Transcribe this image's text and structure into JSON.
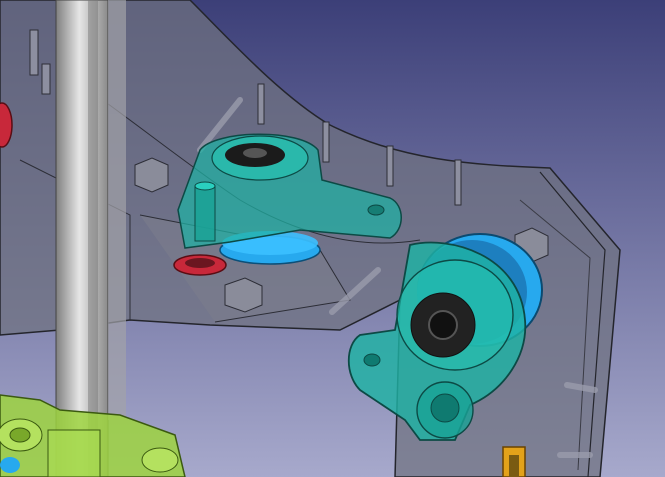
{
  "app": {
    "view": "3D viewport",
    "render_style": "shaded transparent"
  },
  "colors": {
    "background_top": "#3c3f78",
    "background_bottom": "#a7a9cc",
    "housing": "#6f7180",
    "bracket": "#1fb2a4",
    "pulley": "#27a9ee",
    "bearing_red": "#c8283a",
    "rod": "#b7b7b7",
    "carriage": "#9ed43f",
    "marker": "#e3a21a"
  },
  "scene": {
    "objects": [
      {
        "icon": "housing-plate-icon"
      },
      {
        "icon": "smooth-rod-icon"
      },
      {
        "icon": "idler-bracket-upper-icon"
      },
      {
        "icon": "pulley-upper-icon"
      },
      {
        "icon": "red-bearing-icon"
      },
      {
        "icon": "idler-bracket-lower-icon"
      },
      {
        "icon": "pulley-lower-icon"
      },
      {
        "icon": "carriage-icon"
      },
      {
        "icon": "orange-marker-icon"
      }
    ]
  }
}
